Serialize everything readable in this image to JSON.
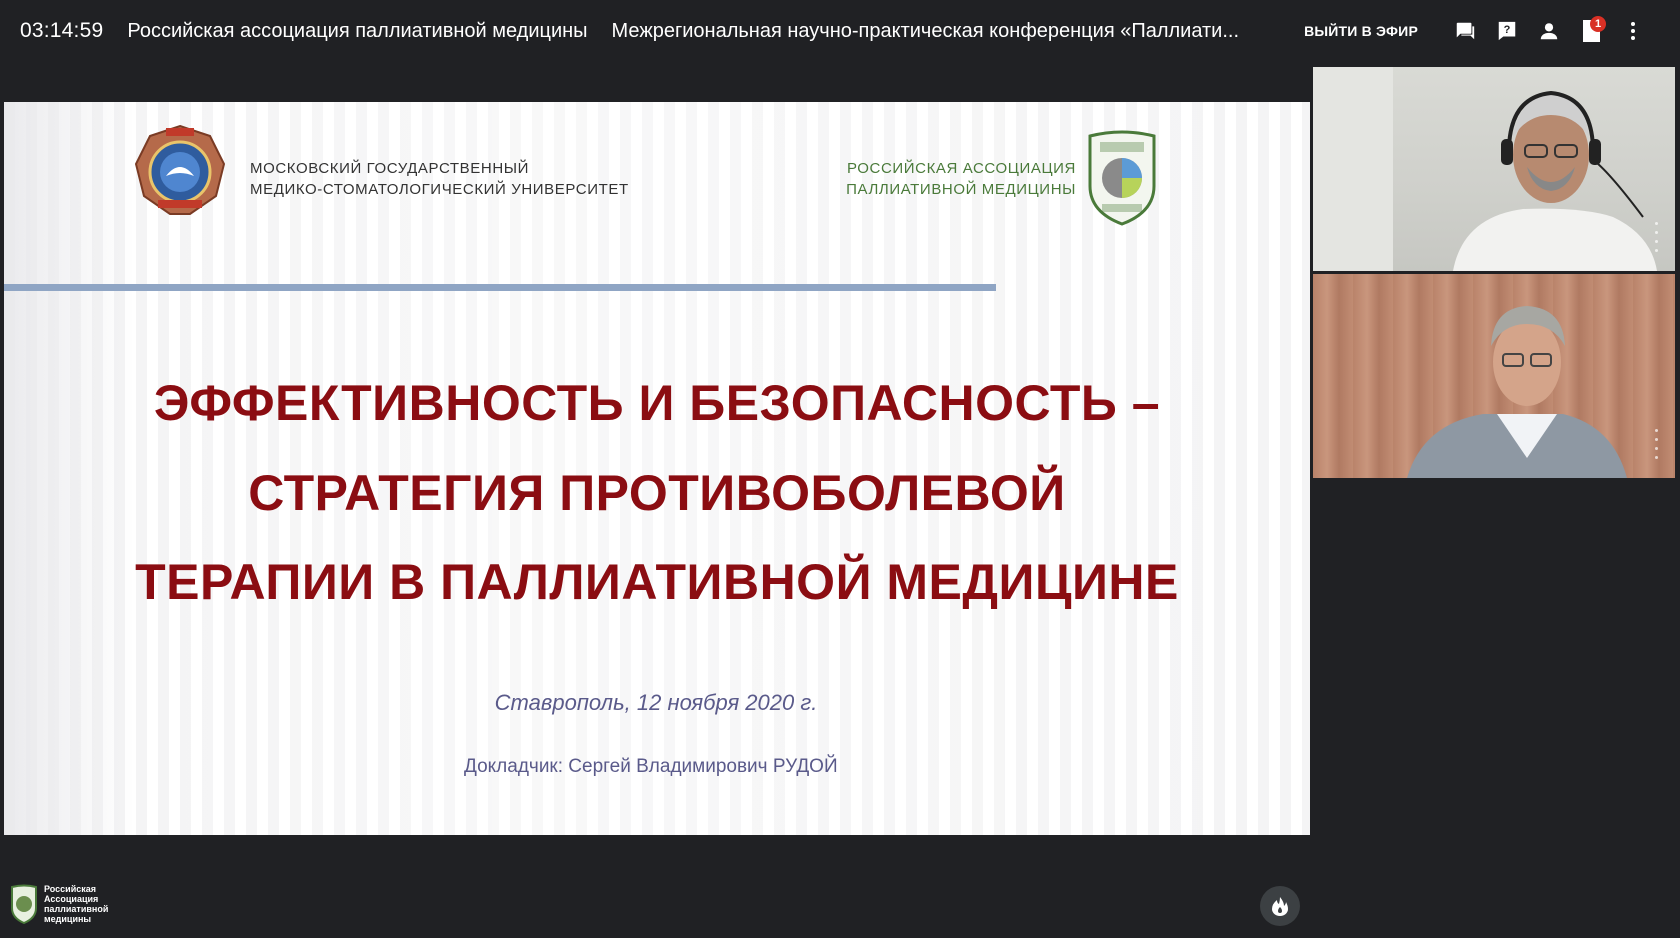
{
  "topbar": {
    "clock": "03:14:59",
    "org_title": "Российская ассоциация паллиативной медицины",
    "conference_title": "Межрегиональная научно-практическая конференция «Паллиати..."
  },
  "toolbar": {
    "live_label": "ВЫЙТИ В ЭФИР",
    "icons": [
      "chat-icon",
      "question-icon",
      "person-icon",
      "file-icon",
      "more-vert-icon"
    ],
    "file_badge": "1"
  },
  "slide": {
    "university_line1": "Московский государственный",
    "university_line2": "медико-стоматологический университет",
    "association_line1": "РОССИЙСКАЯ АССОЦИАЦИЯ",
    "association_line2": "ПАЛЛИАТИВНОЙ МЕДИЦИНЫ",
    "title_line1": "ЭФФЕКТИВНОСТЬ И БЕЗОПАСНОСТЬ –",
    "title_line2": "СТРАТЕГИЯ ПРОТИВОБОЛЕВОЙ",
    "title_line3": "ТЕРАПИИ В ПАЛЛИАТИВНОЙ МЕДИЦИНЕ",
    "place_date": "Ставрополь, 12 ноября 2020 г.",
    "speaker": "Докладчик:  Сергей Владимирович РУДОЙ",
    "colors": {
      "title": "#8b0d12",
      "rule": "#8fa5c4",
      "subtitle": "#5a5a8a"
    }
  },
  "bottom": {
    "logo_line1": "Российская",
    "logo_line2": "Ассоциация",
    "logo_line3": "паллиативной",
    "logo_line4": "медицины",
    "fire_icon": "fire-icon"
  }
}
